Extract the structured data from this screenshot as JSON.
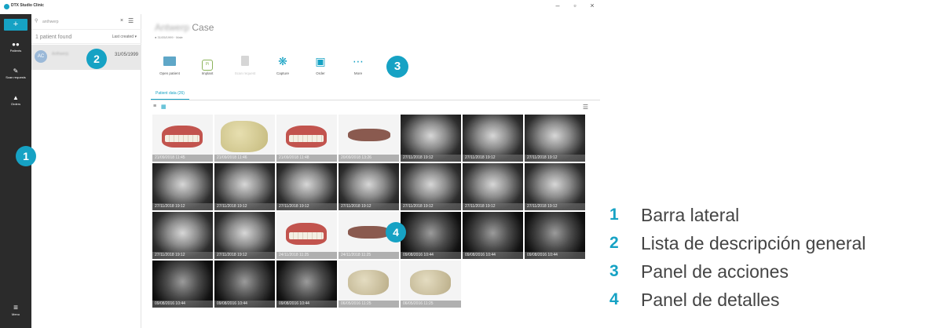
{
  "window": {
    "title": "DTX Studio Clinic",
    "controls": [
      "–",
      "▫",
      "×"
    ]
  },
  "sidebar": {
    "new_button": "+",
    "items": [
      {
        "id": "patients",
        "label": "Patients",
        "icon": "patients-icon"
      },
      {
        "id": "scan",
        "label": "Scan requests",
        "icon": "scan-icon"
      },
      {
        "id": "orders",
        "label": "Orders",
        "icon": "cart-icon"
      },
      {
        "id": "menu",
        "label": "Menu",
        "icon": "menu-icon"
      }
    ]
  },
  "overview": {
    "search_value": "anthwerp",
    "found_text": "1 patient found",
    "sort_label": "Last created",
    "patient": {
      "initials": "AC",
      "name": "Anthwerp",
      "date": "31/05/1999"
    }
  },
  "main": {
    "case_name": "Antwerp",
    "case_word": "Case",
    "case_sub": "31/05/1999 · Male",
    "actions": [
      {
        "id": "open-patient",
        "label": "Open patient",
        "icon": "folder-icon",
        "disabled": false
      },
      {
        "id": "implant",
        "label": "Implant",
        "icon": "implant-icon",
        "disabled": false
      },
      {
        "id": "scan-request",
        "label": "Scan request",
        "icon": "document-icon",
        "disabled": true
      },
      {
        "id": "capture",
        "label": "Capture",
        "icon": "capture-icon",
        "disabled": false
      },
      {
        "id": "order",
        "label": "Order",
        "icon": "cart-icon",
        "disabled": false
      },
      {
        "id": "more",
        "label": "More",
        "icon": "more-icon",
        "disabled": false
      }
    ],
    "tab_label": "Patient data (26)",
    "tiles": [
      {
        "type": "model-red",
        "stamp": "21/09/2018 11:45"
      },
      {
        "type": "model-stone",
        "stamp": "21/09/2018 11:46"
      },
      {
        "type": "model-red",
        "stamp": "21/09/2018 11:48"
      },
      {
        "type": "model-low",
        "stamp": "20/09/2018 13:26"
      },
      {
        "type": "xray",
        "stamp": "27/11/2018 19:12"
      },
      {
        "type": "xray",
        "stamp": "27/11/2018 19:12"
      },
      {
        "type": "xray",
        "stamp": "27/11/2018 19:12"
      },
      {
        "type": "xray",
        "stamp": "27/11/2018 19:12"
      },
      {
        "type": "xray",
        "stamp": "27/11/2018 19:12"
      },
      {
        "type": "xray",
        "stamp": "27/11/2018 19:12"
      },
      {
        "type": "xray",
        "stamp": "27/11/2018 19:12"
      },
      {
        "type": "xray",
        "stamp": "27/11/2018 19:12"
      },
      {
        "type": "xray",
        "stamp": "27/11/2018 19:12"
      },
      {
        "type": "xray",
        "stamp": "27/11/2018 19:12"
      },
      {
        "type": "xray",
        "stamp": "27/11/2018 19:12"
      },
      {
        "type": "xray",
        "stamp": "27/11/2018 19:12"
      },
      {
        "type": "model-red",
        "stamp": "24/11/2018 11:25"
      },
      {
        "type": "model-low",
        "stamp": "24/11/2018 11:25"
      },
      {
        "type": "ct",
        "stamp": "09/08/2016 10:44"
      },
      {
        "type": "ct",
        "stamp": "09/08/2016 10:44"
      },
      {
        "type": "ct",
        "stamp": "09/08/2016 10:44"
      },
      {
        "type": "ct",
        "stamp": "09/08/2016 10:44"
      },
      {
        "type": "ct",
        "stamp": "09/08/2016 10:44"
      },
      {
        "type": "ct",
        "stamp": "09/08/2016 10:44"
      },
      {
        "type": "model-cast",
        "stamp": "06/05/2016 11:25"
      },
      {
        "type": "model-cast",
        "stamp": "06/05/2016 11:25"
      }
    ]
  },
  "callouts": [
    "1",
    "2",
    "3",
    "4"
  ],
  "legend": [
    {
      "num": "1",
      "text": "Barra lateral"
    },
    {
      "num": "2",
      "text": "Lista de descripción general"
    },
    {
      "num": "3",
      "text": "Panel de acciones"
    },
    {
      "num": "4",
      "text": "Panel de detalles"
    }
  ],
  "colors": {
    "accent": "#16a2c4",
    "sidebar": "#2b2b2b"
  }
}
